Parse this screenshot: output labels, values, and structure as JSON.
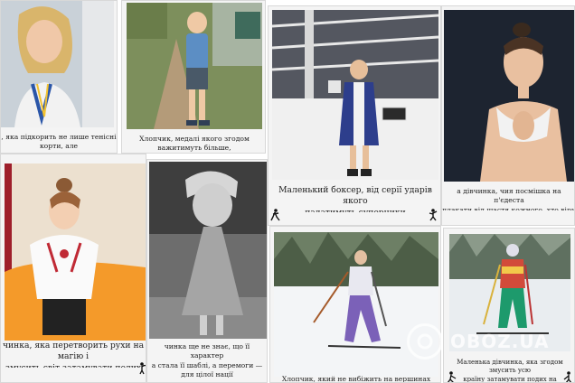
{
  "collage": {
    "cards": [
      {
        "id": "c1",
        "caption": ", яка підкорить не лише тенісні корти, але\nй серця мільйонів людей у всьому світі"
      },
      {
        "id": "c2",
        "caption": "Хлопчик, медалі якого згодом важитимуть більше,\nніж його перший шкільний портфель"
      },
      {
        "id": "c3",
        "caption": "Маленький боксер, від серії ударів якого\nпадатимуть суперники"
      },
      {
        "id": "c4",
        "caption": "а дівчинка, чия посмішка на п'єдеста\nплакати від щастя кожного, хто віри"
      },
      {
        "id": "c5",
        "caption": "чинка, яка перетворить рухи на магію і\nзмусить світ затамувати подих"
      },
      {
        "id": "c6",
        "caption": "чинка ще не знає, що її характер\nа стала її шаблі, а перемоги —\nдля цілої нації"
      },
      {
        "id": "c7",
        "caption": "Хлопчик, який не вибіжить на вершинах момент..."
      },
      {
        "id": "c8",
        "caption": "Маленька дівчинка, яка згодом змусить усю\nкраїну затамувати подих на останньому\nвогневому рубежі"
      }
    ]
  },
  "watermark": {
    "text": "OBOZ.UA"
  },
  "colors": {
    "background": "#ffffff",
    "card": "#f4f4f4"
  }
}
